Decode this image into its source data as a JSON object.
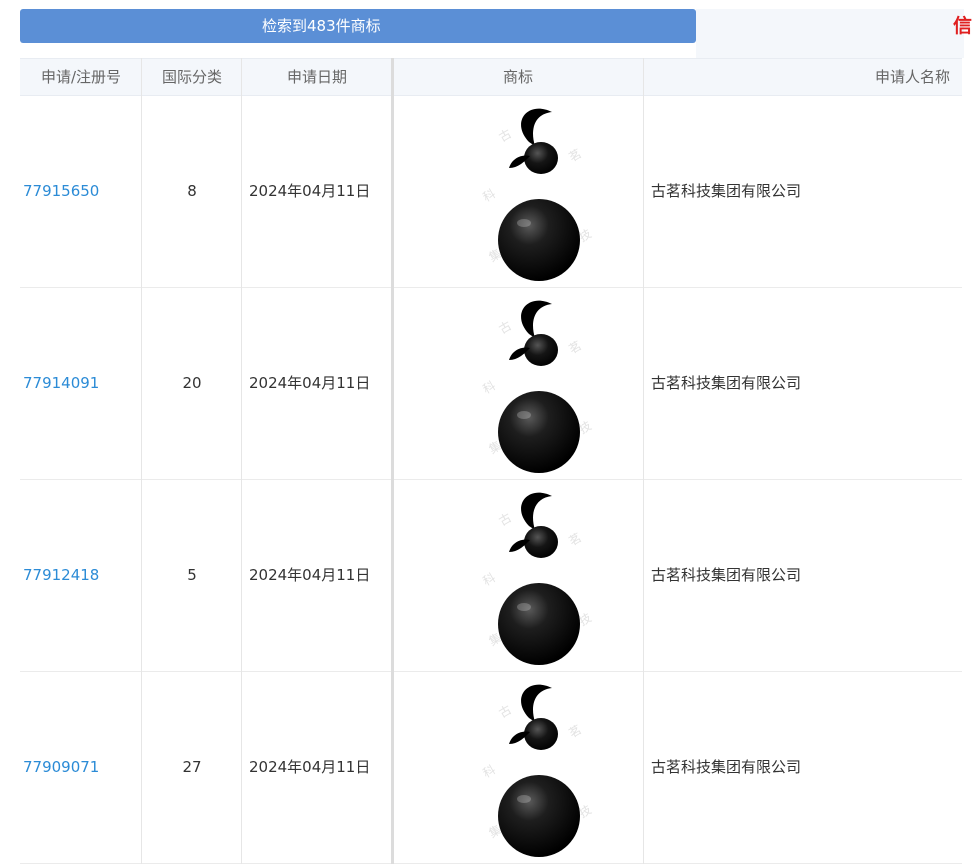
{
  "result_bar": {
    "text": "检索到483件商标"
  },
  "corner_mark": "信",
  "table": {
    "headers": [
      "申请/注册号",
      "国际分类",
      "申请日期",
      "商标",
      "申请人名称"
    ],
    "rows": [
      {
        "reg_no": "77915650",
        "class": "8",
        "date": "2024年04月11日",
        "trademark_image": "gourd-logo",
        "applicant": "古茗科技集团有限公司"
      },
      {
        "reg_no": "77914091",
        "class": "20",
        "date": "2024年04月11日",
        "trademark_image": "gourd-logo",
        "applicant": "古茗科技集团有限公司"
      },
      {
        "reg_no": "77912418",
        "class": "5",
        "date": "2024年04月11日",
        "trademark_image": "gourd-logo",
        "applicant": "古茗科技集团有限公司"
      },
      {
        "reg_no": "77909071",
        "class": "27",
        "date": "2024年04月11日",
        "trademark_image": "gourd-logo",
        "applicant": "古茗科技集团有限公司"
      }
    ]
  },
  "colors": {
    "result_bar_bg": "#5b8fd6",
    "link": "#2b8bd6",
    "header_bg": "#f4f7fb",
    "corner_mark": "#e02020"
  }
}
